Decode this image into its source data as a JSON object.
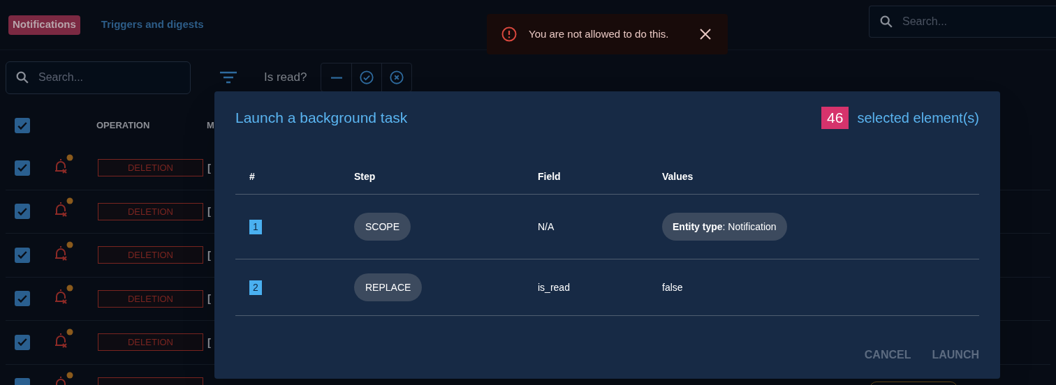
{
  "tabs": [
    {
      "label": "Notifications",
      "selected": true
    },
    {
      "label": "Triggers and digests",
      "selected": false
    }
  ],
  "top_search": {
    "placeholder": "Search..."
  },
  "toast": {
    "message": "You are not allowed to do this."
  },
  "filters": {
    "search_placeholder": "Search...",
    "is_read_label": "Is read?",
    "is_read_options": [
      {
        "kind": "any",
        "selected": false
      },
      {
        "kind": "read",
        "selected": false
      },
      {
        "kind": "unread",
        "selected": false
      }
    ]
  },
  "table": {
    "select_all_checked": true,
    "columns": [
      "OPERATION",
      "M"
    ],
    "rows": [
      {
        "checked": true,
        "unread": true,
        "operation": "DELETION",
        "message": "["
      },
      {
        "checked": true,
        "unread": true,
        "operation": "DELETION",
        "message": "["
      },
      {
        "checked": true,
        "unread": true,
        "operation": "DELETION",
        "message": "["
      },
      {
        "checked": true,
        "unread": true,
        "operation": "DELETION",
        "message": "["
      },
      {
        "checked": true,
        "unread": true,
        "operation": "DELETION",
        "message": "["
      },
      {
        "checked": true,
        "unread": true
      }
    ]
  },
  "dialog": {
    "title": "Launch a background task",
    "count": "46",
    "count_label": "selected element(s)",
    "columns": [
      "#",
      "Step",
      "Field",
      "Values"
    ],
    "steps": [
      {
        "number": "1",
        "step": "SCOPE",
        "field": "N/A",
        "kind": "chip",
        "value": "**Entity type**: Notification"
      },
      {
        "number": "2",
        "step": "REPLACE",
        "field": "is_read",
        "kind": "text",
        "value": "false"
      }
    ],
    "buttons": [
      {
        "label": "CANCEL",
        "disabled": true
      },
      {
        "label": "LAUNCH",
        "disabled": true
      }
    ]
  }
}
